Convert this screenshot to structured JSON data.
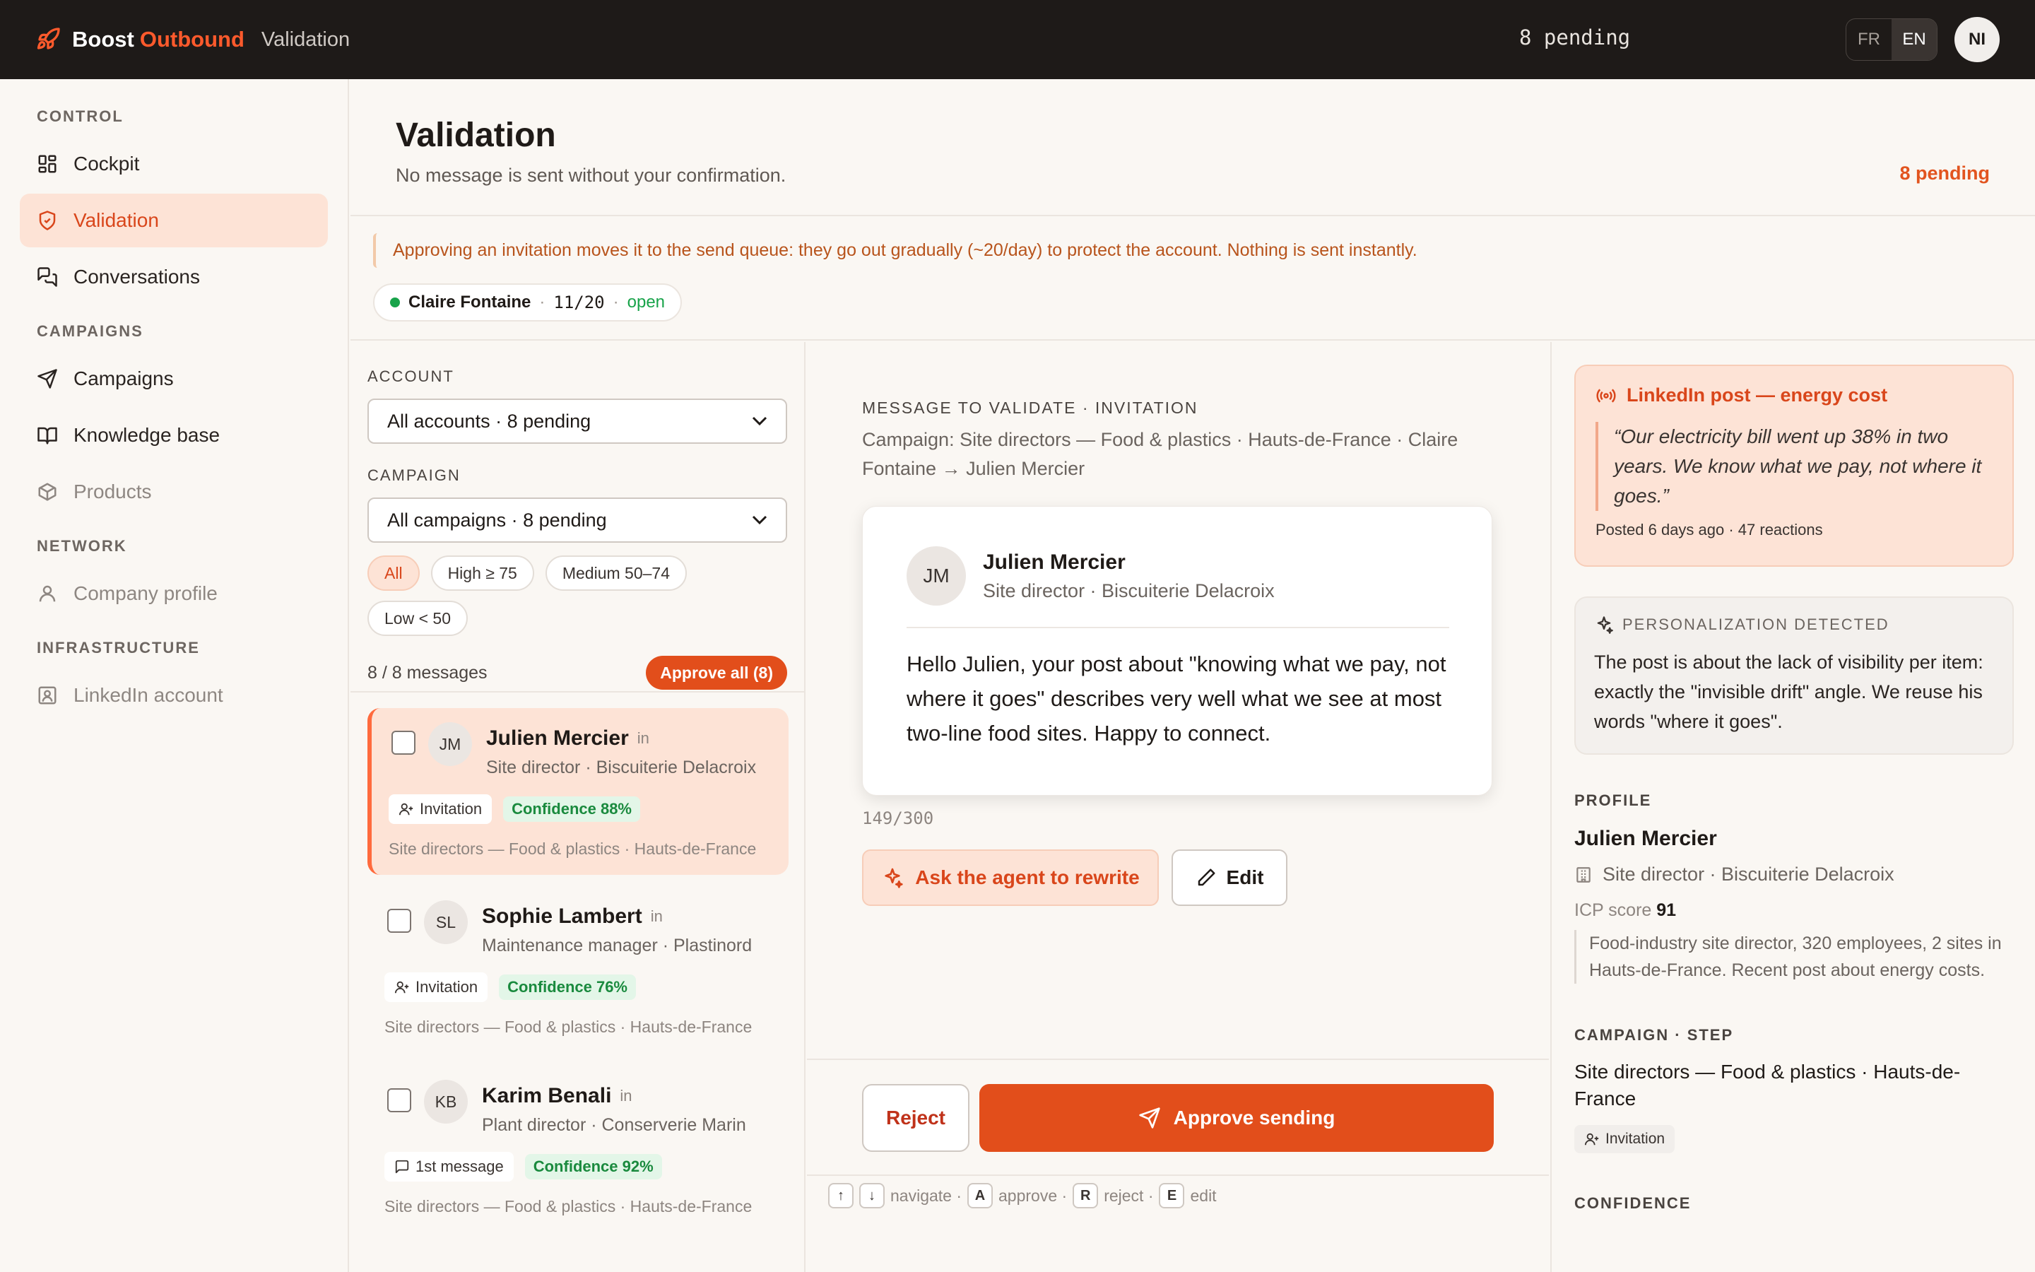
{
  "topbar": {
    "brand_part1": "Boost",
    "brand_part2": "Outbound",
    "breadcrumb": "Validation",
    "pending": "8 pending",
    "lang_fr": "FR",
    "lang_en": "EN",
    "user_initials": "NI"
  },
  "sidebar": {
    "sections": [
      {
        "label": "CONTROL",
        "items": [
          {
            "label": "Cockpit",
            "icon": "dashboard-icon"
          },
          {
            "label": "Validation",
            "icon": "shield-check-icon",
            "active": true
          },
          {
            "label": "Conversations",
            "icon": "chat-icon"
          }
        ]
      },
      {
        "label": "CAMPAIGNS",
        "items": [
          {
            "label": "Campaigns",
            "icon": "send-icon"
          },
          {
            "label": "Knowledge base",
            "icon": "book-icon"
          },
          {
            "label": "Products",
            "icon": "box-icon"
          }
        ]
      },
      {
        "label": "NETWORK",
        "items": [
          {
            "label": "Company profile",
            "icon": "user-icon"
          }
        ]
      },
      {
        "label": "INFRASTRUCTURE",
        "items": [
          {
            "label": "LinkedIn account",
            "icon": "id-card-icon"
          }
        ]
      }
    ]
  },
  "page": {
    "title": "Validation",
    "subtitle": "No message is sent without your confirmation.",
    "pending": "8 pending"
  },
  "notice": {
    "text": "Approving an invitation moves it to the send queue: they go out gradually (~20/day) to protect the account. Nothing is sent instantly.",
    "account_name": "Claire Fontaine",
    "account_quota": "11/20",
    "account_status": "open"
  },
  "filters": {
    "account_label": "ACCOUNT",
    "account_value": "All accounts · 8 pending",
    "campaign_label": "CAMPAIGN",
    "campaign_value": "All campaigns · 8 pending",
    "pills": [
      "All",
      "High ≥ 75",
      "Medium 50–74",
      "Low < 50"
    ],
    "count": "8 / 8 messages",
    "approve_all": "Approve all (8)"
  },
  "queue": [
    {
      "initials": "JM",
      "name": "Julien Mercier",
      "role": "Site director · Biscuiterie Delacroix",
      "type": "Invitation",
      "confidence": "Confidence 88%",
      "campaign": "Site directors — Food & plastics · Hauts-de-France",
      "selected": true
    },
    {
      "initials": "SL",
      "name": "Sophie Lambert",
      "role": "Maintenance manager · Plastinord",
      "type": "Invitation",
      "confidence": "Confidence 76%",
      "campaign": "Site directors — Food & plastics · Hauts-de-France",
      "selected": false
    },
    {
      "initials": "KB",
      "name": "Karim Benali",
      "role": "Plant director · Conserverie Marin",
      "type": "1st message",
      "confidence": "Confidence 92%",
      "campaign": "Site directors — Food & plastics · Hauts-de-France",
      "selected": false
    }
  ],
  "message": {
    "label": "MESSAGE TO VALIDATE · INVITATION",
    "meta": "Campaign: Site directors — Food & plastics · Hauts-de-France · Claire Fontaine → Julien Mercier",
    "initials": "JM",
    "name": "Julien Mercier",
    "role": "Site director · Biscuiterie Delacroix",
    "body": "Hello Julien, your post about \"knowing what we pay, not where it goes\" describes very well what we see at most two-line food sites. Happy to connect.",
    "char_count": "149/300",
    "rewrite_label": "Ask the agent to rewrite",
    "edit_label": "Edit",
    "reject_label": "Reject",
    "approve_label": "Approve sending"
  },
  "shortcuts": {
    "up": "↑",
    "down": "↓",
    "navigate": "navigate ·",
    "a": "A",
    "approve": "approve ·",
    "r": "R",
    "reject": "reject ·",
    "e": "E",
    "edit": "edit"
  },
  "insight": {
    "post_title": "LinkedIn post — energy cost",
    "post_quote": "“Our electricity bill went up 38% in two years. We know what we pay, not where it goes.”",
    "post_meta": "Posted 6 days ago · 47 reactions",
    "perso_label": "PERSONALIZATION DETECTED",
    "perso_text": "The post is about the lack of visibility per item: exactly the \"invisible drift\" angle. We reuse his words \"where it goes\".",
    "profile_label": "PROFILE",
    "profile_name": "Julien Mercier",
    "profile_role": "Site director · Biscuiterie Delacroix",
    "icp_label": "ICP score",
    "icp_value": "91",
    "profile_desc": "Food-industry site director, 320 employees, 2 sites in Hauts-de-France. Recent post about energy costs.",
    "campaign_label": "CAMPAIGN · STEP",
    "campaign_name": "Site directors — Food & plastics · Hauts-de-France",
    "campaign_tag": "Invitation",
    "confidence_label": "CONFIDENCE"
  },
  "colors": {
    "accent": "#e24e1b",
    "accent_soft": "#fde3d6",
    "topbar": "#1e1a18",
    "success": "#18a34a"
  }
}
